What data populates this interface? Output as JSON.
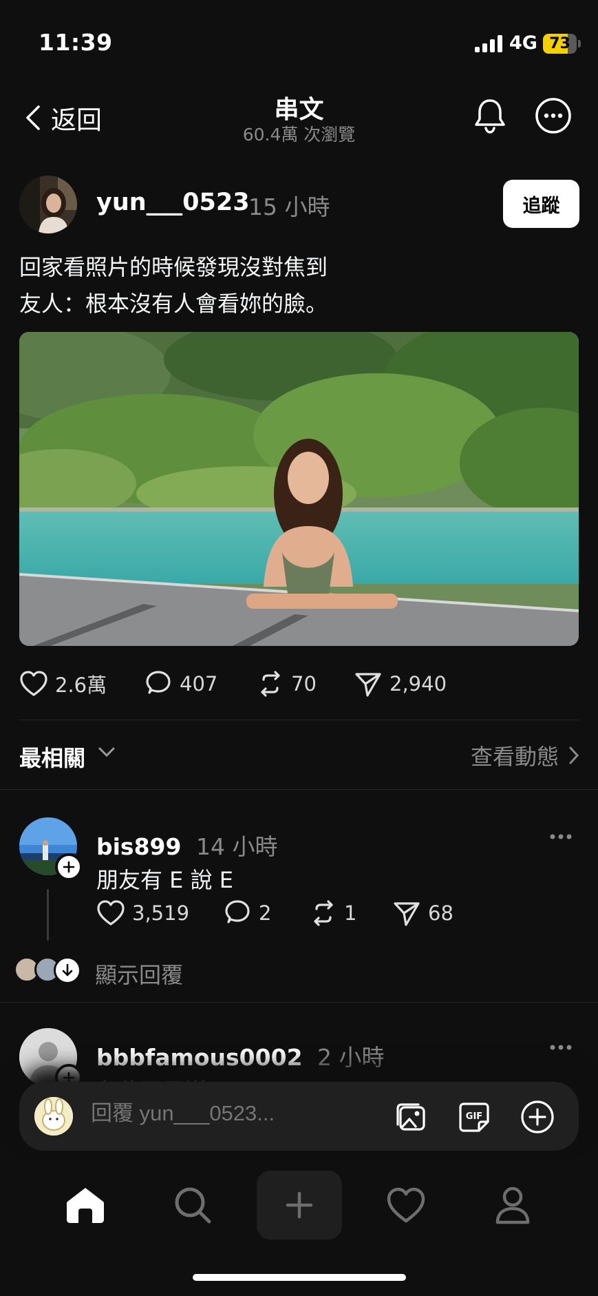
{
  "status": {
    "time": "11:39",
    "network": "4G",
    "battery": "73",
    "battery_level": 0.73
  },
  "header": {
    "back_label": "返回",
    "title": "串文",
    "subtitle": "60.4萬 次瀏覽"
  },
  "post": {
    "username": "yun___0523",
    "time": "15 小時",
    "follow_label": "追蹤",
    "text_line1": "回家看照片的時候發現沒對焦到",
    "text_line2": "友人：根本沒有人會看妳的臉。",
    "likes": "2.6萬",
    "comments": "407",
    "reposts": "70",
    "shares": "2,940"
  },
  "sort": {
    "label": "最相關",
    "activity_label": "查看動態"
  },
  "replies": [
    {
      "username": "bis899",
      "time": "14 小時",
      "text": "朋友有 E 說 E",
      "likes": "3,519",
      "comments": "2",
      "reposts": "1",
      "shares": "68"
    },
    {
      "username": "bbbfamous0002",
      "time": "2 小時",
      "text": "各位不用謝"
    }
  ],
  "show_replies_label": "顯示回覆",
  "compose": {
    "placeholder": "回覆 yun___0523..."
  },
  "colors": {
    "background": "#0f0f0f",
    "muted": "#8a8a8a",
    "battery": "#f5d000"
  }
}
